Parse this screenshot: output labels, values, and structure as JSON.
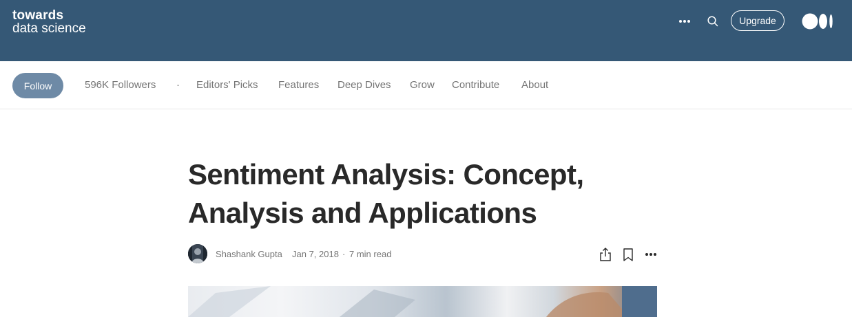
{
  "header": {
    "logo_line1": "towards",
    "logo_line2": "data science",
    "upgrade_label": "Upgrade"
  },
  "subnav": {
    "follow_label": "Follow",
    "followers": "596K Followers",
    "separator": "·",
    "items": [
      "Editors' Picks",
      "Features",
      "Deep Dives",
      "Grow",
      "Contribute",
      "About"
    ]
  },
  "article": {
    "title": "Sentiment Analysis: Concept, Analysis and Applications",
    "author": "Shashank Gupta",
    "date": "Jan 7, 2018",
    "dot": "·",
    "read_time": "7 min read"
  },
  "icons": {
    "more": "more-horizontal-icon",
    "search": "search-icon",
    "medium": "medium-logo-icon",
    "share": "share-icon",
    "bookmark": "bookmark-icon",
    "article_more": "more-horizontal-icon"
  },
  "colors": {
    "header_bg": "#355876",
    "follow_bg": "#6e8aa6"
  }
}
